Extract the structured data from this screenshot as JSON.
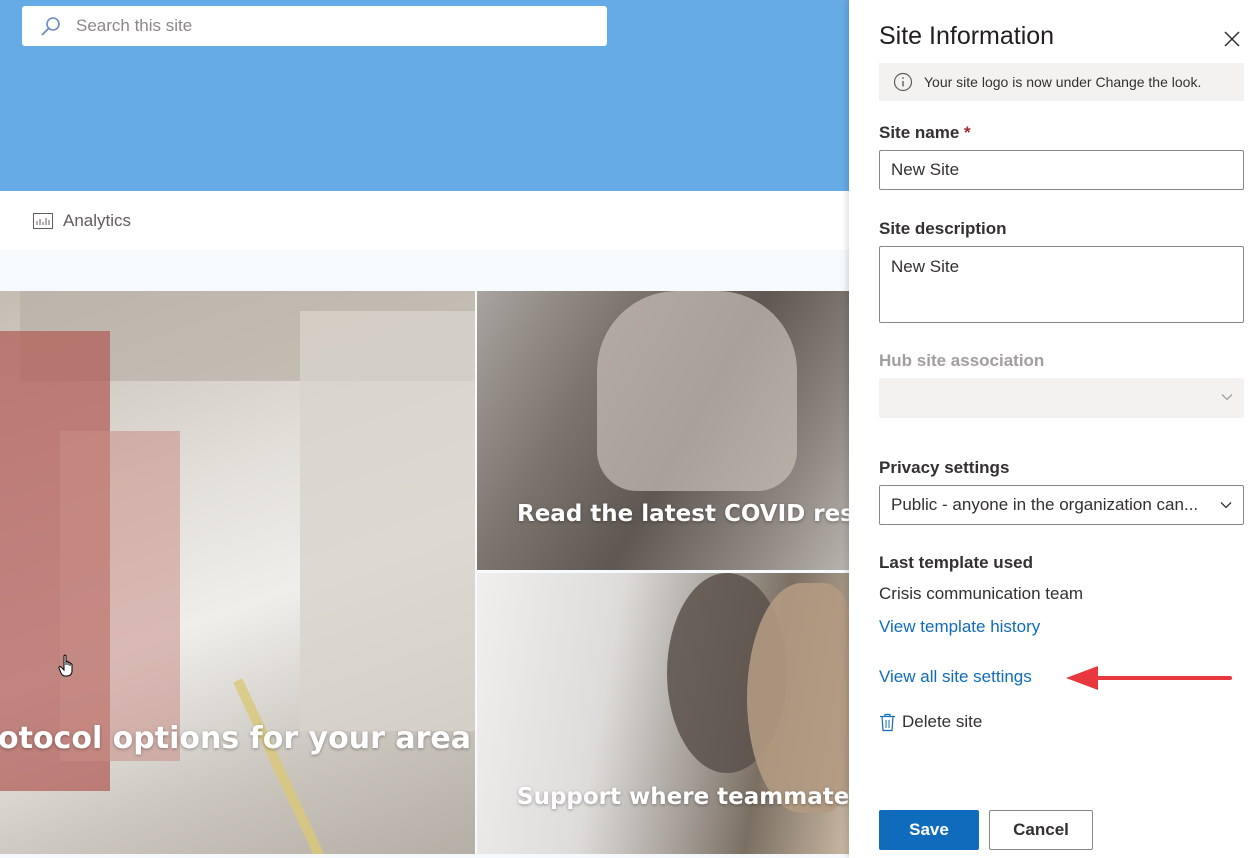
{
  "site": {
    "search_placeholder": "Search this site",
    "nav_item": "Analytics",
    "tiles": {
      "big_headline": "otocol options for your area",
      "top_headline": "Read the latest COVID respon",
      "bottom_headline": "Support where teammates ne"
    },
    "header_color": "#66abe6"
  },
  "panel": {
    "title": "Site Information",
    "info_message": "Your site logo is now under Change the look.",
    "site_name_label": "Site name",
    "required_marker": "*",
    "site_name_value": "New Site",
    "site_description_label": "Site description",
    "site_description_value": "New Site",
    "hub_label": "Hub site association",
    "hub_value": "",
    "privacy_label": "Privacy settings",
    "privacy_value": "Public - anyone in the organization can...",
    "last_template_label": "Last template used",
    "last_template_value": "Crisis communication team",
    "view_template_history": "View template history",
    "view_all_settings": "View all site settings",
    "delete_site": "Delete site",
    "save_label": "Save",
    "cancel_label": "Cancel"
  },
  "colors": {
    "accent": "#0f6cbd",
    "annotation_arrow": "#e8383d"
  }
}
